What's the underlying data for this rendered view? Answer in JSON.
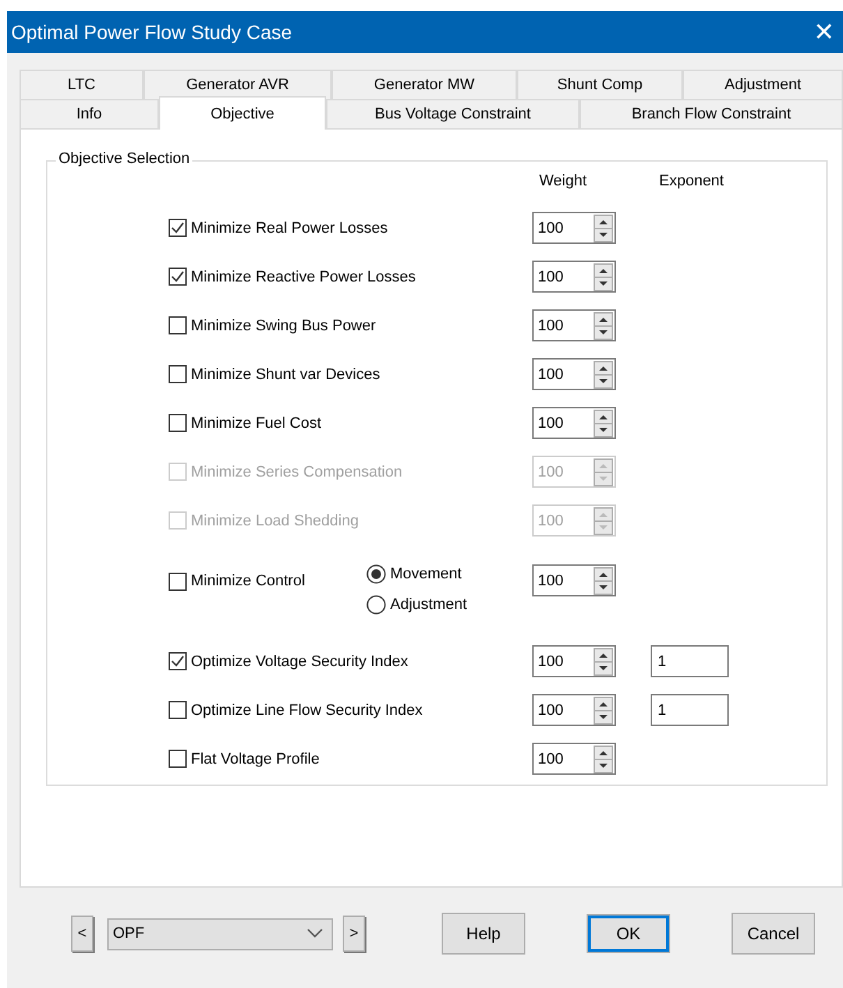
{
  "window": {
    "title": "Optimal Power Flow Study Case",
    "close": "✕"
  },
  "tab_rows": [
    [
      {
        "label": "LTC",
        "selected": false
      },
      {
        "label": "Generator AVR",
        "selected": false
      },
      {
        "label": "Generator MW",
        "selected": false
      },
      {
        "label": "Shunt Comp",
        "selected": false
      },
      {
        "label": "Adjustment",
        "selected": false
      }
    ],
    [
      {
        "label": "Info",
        "selected": false
      },
      {
        "label": "Objective",
        "selected": true
      },
      {
        "label": "Bus Voltage Constraint",
        "selected": false
      },
      {
        "label": "Branch Flow Constraint",
        "selected": false
      }
    ]
  ],
  "group": {
    "title": "Objective Selection",
    "columns": [
      "Weight",
      "Exponent"
    ],
    "objectives": [
      {
        "kind": "check",
        "label": "Minimize Real Power Losses",
        "checked": true,
        "disabled": false,
        "weight": "100"
      },
      {
        "kind": "check",
        "label": "Minimize Reactive Power Losses",
        "checked": true,
        "disabled": false,
        "weight": "100"
      },
      {
        "kind": "check",
        "label": "Minimize Swing Bus Power",
        "checked": false,
        "disabled": false,
        "weight": "100"
      },
      {
        "kind": "check",
        "label": "Minimize Shunt var Devices",
        "checked": false,
        "disabled": false,
        "weight": "100"
      },
      {
        "kind": "check",
        "label": "Minimize Fuel Cost",
        "checked": false,
        "disabled": false,
        "weight": "100"
      },
      {
        "kind": "check",
        "label": "Minimize Series Compensation",
        "checked": false,
        "disabled": true,
        "weight": "100"
      },
      {
        "kind": "check",
        "label": "Minimize Load Shedding",
        "checked": false,
        "disabled": true,
        "weight": "100"
      },
      {
        "kind": "control",
        "label": "Minimize Control",
        "checked": false,
        "disabled": false,
        "weight": "100",
        "options": [
          {
            "label": "Movement",
            "selected": true
          },
          {
            "label": "Adjustment",
            "selected": false
          }
        ]
      },
      {
        "kind": "check",
        "label": "Optimize Voltage Security Index",
        "checked": true,
        "disabled": false,
        "weight": "100",
        "exponent": "1"
      },
      {
        "kind": "check",
        "label": "Optimize Line Flow Security Index",
        "checked": false,
        "disabled": false,
        "weight": "100",
        "exponent": "1"
      },
      {
        "kind": "check",
        "label": "Flat Voltage Profile",
        "checked": false,
        "disabled": false,
        "weight": "100"
      }
    ]
  },
  "footer": {
    "prev": "<",
    "case": "OPF",
    "next": ">",
    "buttons": [
      {
        "label": "Help",
        "default": false
      },
      {
        "label": "OK",
        "default": true
      },
      {
        "label": "Cancel",
        "default": false
      }
    ]
  }
}
